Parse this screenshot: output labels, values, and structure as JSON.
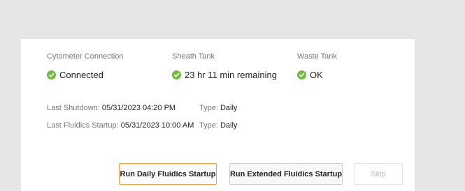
{
  "colors": {
    "background": "#e6e6e6",
    "card": "#ffffff",
    "success": "#6dbb3f",
    "primary_border": "#f0a13a"
  },
  "status": [
    {
      "heading": "Cytometer Connection",
      "value": "Connected",
      "icon": "check-circle-icon"
    },
    {
      "heading": "Sheath Tank",
      "value": "23 hr 11 min remaining",
      "icon": "check-circle-icon"
    },
    {
      "heading": "Waste Tank",
      "value": "OK",
      "icon": "check-circle-icon"
    }
  ],
  "info": {
    "last_shutdown": {
      "label": "Last Shutdown:",
      "value": "05/31/2023 04:20 PM",
      "type_label": "Type:",
      "type_value": "Daily"
    },
    "last_startup": {
      "label": "Last Fluidics Startup:",
      "value": "05/31/2023 10:00 AM",
      "type_label": "Type:",
      "type_value": "Daily"
    }
  },
  "buttons": {
    "daily_startup": "Run Daily Fluidics Startup",
    "extended_startup": "Run Extended Fluidics Startup",
    "skip": "Skip"
  }
}
